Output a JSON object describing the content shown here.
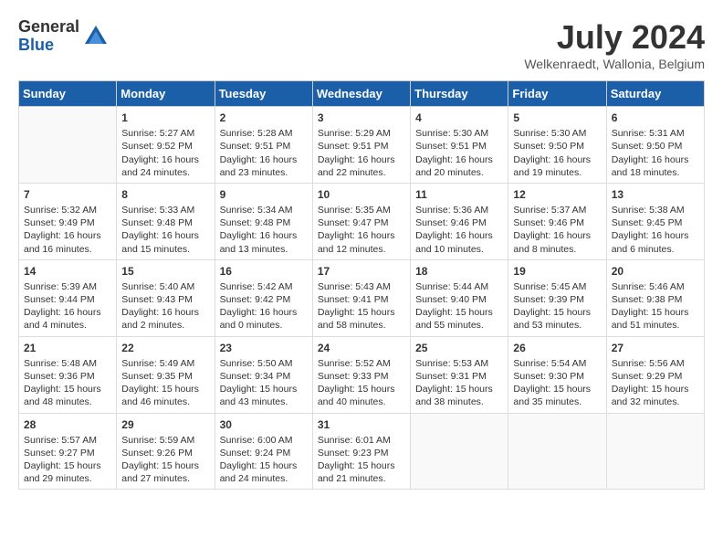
{
  "header": {
    "logo_general": "General",
    "logo_blue": "Blue",
    "month": "July 2024",
    "location": "Welkenraedt, Wallonia, Belgium"
  },
  "weekdays": [
    "Sunday",
    "Monday",
    "Tuesday",
    "Wednesday",
    "Thursday",
    "Friday",
    "Saturday"
  ],
  "weeks": [
    [
      {
        "day": "",
        "info": ""
      },
      {
        "day": "1",
        "info": "Sunrise: 5:27 AM\nSunset: 9:52 PM\nDaylight: 16 hours\nand 24 minutes."
      },
      {
        "day": "2",
        "info": "Sunrise: 5:28 AM\nSunset: 9:51 PM\nDaylight: 16 hours\nand 23 minutes."
      },
      {
        "day": "3",
        "info": "Sunrise: 5:29 AM\nSunset: 9:51 PM\nDaylight: 16 hours\nand 22 minutes."
      },
      {
        "day": "4",
        "info": "Sunrise: 5:30 AM\nSunset: 9:51 PM\nDaylight: 16 hours\nand 20 minutes."
      },
      {
        "day": "5",
        "info": "Sunrise: 5:30 AM\nSunset: 9:50 PM\nDaylight: 16 hours\nand 19 minutes."
      },
      {
        "day": "6",
        "info": "Sunrise: 5:31 AM\nSunset: 9:50 PM\nDaylight: 16 hours\nand 18 minutes."
      }
    ],
    [
      {
        "day": "7",
        "info": "Sunrise: 5:32 AM\nSunset: 9:49 PM\nDaylight: 16 hours\nand 16 minutes."
      },
      {
        "day": "8",
        "info": "Sunrise: 5:33 AM\nSunset: 9:48 PM\nDaylight: 16 hours\nand 15 minutes."
      },
      {
        "day": "9",
        "info": "Sunrise: 5:34 AM\nSunset: 9:48 PM\nDaylight: 16 hours\nand 13 minutes."
      },
      {
        "day": "10",
        "info": "Sunrise: 5:35 AM\nSunset: 9:47 PM\nDaylight: 16 hours\nand 12 minutes."
      },
      {
        "day": "11",
        "info": "Sunrise: 5:36 AM\nSunset: 9:46 PM\nDaylight: 16 hours\nand 10 minutes."
      },
      {
        "day": "12",
        "info": "Sunrise: 5:37 AM\nSunset: 9:46 PM\nDaylight: 16 hours\nand 8 minutes."
      },
      {
        "day": "13",
        "info": "Sunrise: 5:38 AM\nSunset: 9:45 PM\nDaylight: 16 hours\nand 6 minutes."
      }
    ],
    [
      {
        "day": "14",
        "info": "Sunrise: 5:39 AM\nSunset: 9:44 PM\nDaylight: 16 hours\nand 4 minutes."
      },
      {
        "day": "15",
        "info": "Sunrise: 5:40 AM\nSunset: 9:43 PM\nDaylight: 16 hours\nand 2 minutes."
      },
      {
        "day": "16",
        "info": "Sunrise: 5:42 AM\nSunset: 9:42 PM\nDaylight: 16 hours\nand 0 minutes."
      },
      {
        "day": "17",
        "info": "Sunrise: 5:43 AM\nSunset: 9:41 PM\nDaylight: 15 hours\nand 58 minutes."
      },
      {
        "day": "18",
        "info": "Sunrise: 5:44 AM\nSunset: 9:40 PM\nDaylight: 15 hours\nand 55 minutes."
      },
      {
        "day": "19",
        "info": "Sunrise: 5:45 AM\nSunset: 9:39 PM\nDaylight: 15 hours\nand 53 minutes."
      },
      {
        "day": "20",
        "info": "Sunrise: 5:46 AM\nSunset: 9:38 PM\nDaylight: 15 hours\nand 51 minutes."
      }
    ],
    [
      {
        "day": "21",
        "info": "Sunrise: 5:48 AM\nSunset: 9:36 PM\nDaylight: 15 hours\nand 48 minutes."
      },
      {
        "day": "22",
        "info": "Sunrise: 5:49 AM\nSunset: 9:35 PM\nDaylight: 15 hours\nand 46 minutes."
      },
      {
        "day": "23",
        "info": "Sunrise: 5:50 AM\nSunset: 9:34 PM\nDaylight: 15 hours\nand 43 minutes."
      },
      {
        "day": "24",
        "info": "Sunrise: 5:52 AM\nSunset: 9:33 PM\nDaylight: 15 hours\nand 40 minutes."
      },
      {
        "day": "25",
        "info": "Sunrise: 5:53 AM\nSunset: 9:31 PM\nDaylight: 15 hours\nand 38 minutes."
      },
      {
        "day": "26",
        "info": "Sunrise: 5:54 AM\nSunset: 9:30 PM\nDaylight: 15 hours\nand 35 minutes."
      },
      {
        "day": "27",
        "info": "Sunrise: 5:56 AM\nSunset: 9:29 PM\nDaylight: 15 hours\nand 32 minutes."
      }
    ],
    [
      {
        "day": "28",
        "info": "Sunrise: 5:57 AM\nSunset: 9:27 PM\nDaylight: 15 hours\nand 29 minutes."
      },
      {
        "day": "29",
        "info": "Sunrise: 5:59 AM\nSunset: 9:26 PM\nDaylight: 15 hours\nand 27 minutes."
      },
      {
        "day": "30",
        "info": "Sunrise: 6:00 AM\nSunset: 9:24 PM\nDaylight: 15 hours\nand 24 minutes."
      },
      {
        "day": "31",
        "info": "Sunrise: 6:01 AM\nSunset: 9:23 PM\nDaylight: 15 hours\nand 21 minutes."
      },
      {
        "day": "",
        "info": ""
      },
      {
        "day": "",
        "info": ""
      },
      {
        "day": "",
        "info": ""
      }
    ]
  ]
}
